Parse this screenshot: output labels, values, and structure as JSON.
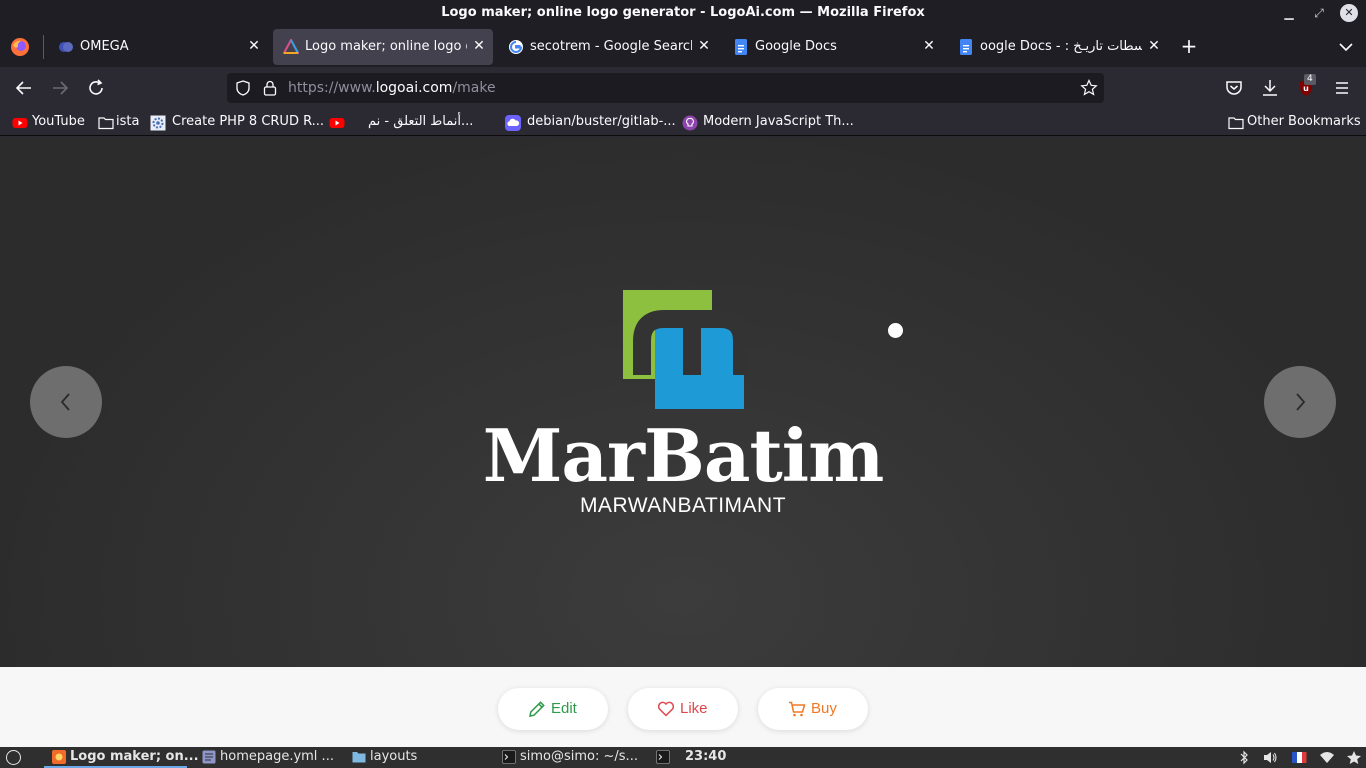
{
  "window": {
    "title": "Logo maker; online logo generator - LogoAi.com — Mozilla Firefox"
  },
  "tabs": [
    {
      "label": "OMEGA",
      "icon": "omega-favicon"
    },
    {
      "label": "Logo maker; online logo generator - LogoAi.com",
      "icon": "logoai-favicon",
      "active": true
    },
    {
      "label": "secotrem - Google Search",
      "icon": "google-favicon"
    },
    {
      "label": "Google Docs",
      "icon": "docs-favicon"
    },
    {
      "label": "Google Docs - : سطات تاريخ",
      "display": "oogle Docs - : سطات تاريـخ",
      "icon": "docs-favicon"
    }
  ],
  "url": {
    "prefix": "https://www.",
    "domain": "logoai.com",
    "path": "/make"
  },
  "extensions": {
    "ublock_badge": "4"
  },
  "bookmarks": [
    {
      "label": "YouTube",
      "icon": "youtube-icon"
    },
    {
      "label": "ista",
      "icon": "folder-icon"
    },
    {
      "label": "Create PHP 8 CRUD R...",
      "icon": "gear-site-icon"
    },
    {
      "label": "",
      "icon": "youtube-icon"
    },
    {
      "label": "أنماط التعلق - نم...",
      "icon": "none"
    },
    {
      "label": "debian/buster/gitlab-...",
      "icon": "cloud-icon"
    },
    {
      "label": "Modern JavaScript Th...",
      "icon": "bulb-icon"
    },
    {
      "label": "Other Bookmarks",
      "icon": "folder-icon"
    }
  ],
  "logo": {
    "name": "MarBatim",
    "tagline": "MARWANBATIMANT",
    "colors": {
      "green": "#8dc03f",
      "blue": "#1e9ad6"
    }
  },
  "actions": {
    "edit": "Edit",
    "like": "Like",
    "buy": "Buy"
  },
  "taskbar": {
    "items": [
      {
        "label": "Logo maker; on...",
        "icon": "firefox-icon"
      },
      {
        "label": "homepage.yml ...",
        "icon": "text-editor-icon"
      },
      {
        "label": "layouts",
        "icon": "folder-icon"
      },
      {
        "label": "simo@simo: ~/s...",
        "icon": "terminal-icon"
      },
      {
        "label": "",
        "icon": "terminal-icon"
      }
    ],
    "clock": "23:40",
    "tray": [
      "bluetooth-icon",
      "volume-icon",
      "french-flag-icon",
      "wifi-icon",
      "star-icon"
    ]
  },
  "colors": {
    "accent_edit": "#2e9a49",
    "accent_like": "#e0474c",
    "accent_buy": "#f07824"
  }
}
